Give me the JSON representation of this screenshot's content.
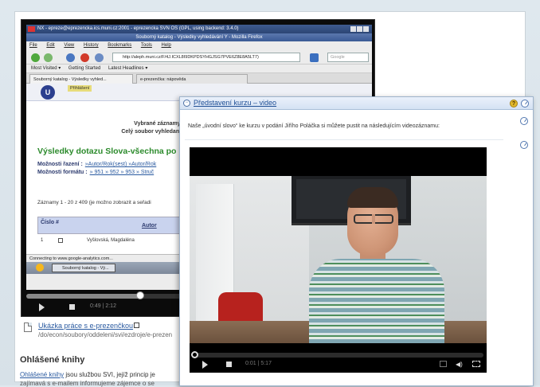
{
  "nx_bar": {
    "title": "NX - epreze@eprezencka.ics.muni.cz:2001 - eprezencka SVN OS (GPL, using backend: 3.4.0)"
  },
  "firefox": {
    "title": "Souborný katalog - Výsledky vyhledávání Y - Mozilla Firefox",
    "menu": [
      "File",
      "Edit",
      "View",
      "History",
      "Bookmarks",
      "Tools",
      "Help"
    ],
    "url": "http://aleph.muni.cz/F/4J.ICXL8I9DKPDSYHGJSG7PVE6Z8E8A5LT7)",
    "search_placeholder": "Google",
    "bookmarks": [
      "Most Visited ▾",
      "Getting Started",
      "Latest Headlines ▾"
    ],
    "tabs": [
      "Souborný katalog - Výsledky vyhled...",
      "e-prezenčka: nápověda"
    ],
    "status": "Connecting to www.google-analytics.com...",
    "taskbar_item": "Souborný katalog - Vý..."
  },
  "aleph": {
    "logo": "U",
    "login": "Přihlášení",
    "selected_line1": "Vybrané záznamy:",
    "selected_line2": "Celý soubor vyhledaný",
    "heading": "Výsledky dotazu Slova-všechna po",
    "sort_label": "Možnosti řazení :",
    "sort_opts": "»Autor/Rok(sest)  »Autor/Rok",
    "format_label": "Možnosti formátu :",
    "format_opts": "» 951  » 952  » 953  » Struč",
    "records": "Záznamy 1 - 20 z 409 (je možno zobrazit a seřadi",
    "col_number": "Číslo #",
    "col_author": "Autor",
    "row1_num": "1",
    "row1_author": "Vyšlovská, Magdaléna"
  },
  "left_player": {
    "time": "0:49 | 2:12",
    "progress": 0.33
  },
  "doc_link": {
    "title": "Ukázka práce s e-prezenčkou",
    "path": "/do/econ/soubory/oddeleni/svi/ezdroje/e-prezen"
  },
  "section": {
    "title": "Ohlášené knihy",
    "link": "Ohlášené knihy",
    "text": " jsou službou SVI, jejíž princip je",
    "sub": "zajímavá s e-mailem informujeme zájemce o se"
  },
  "video_window": {
    "title": "Představení kurzu – video",
    "help": "?",
    "intro": "Naše „úvodní slovo“ ke kurzu v podání Jiřího Poláčka si můžete pustit na následujícím videozáznamu:",
    "time": "0:01 | 5:17",
    "progress": 0.0
  },
  "colors": {
    "link": "#1f4f95",
    "heading_green": "#2b8a2b",
    "header_bg": "#d5e2f3"
  }
}
